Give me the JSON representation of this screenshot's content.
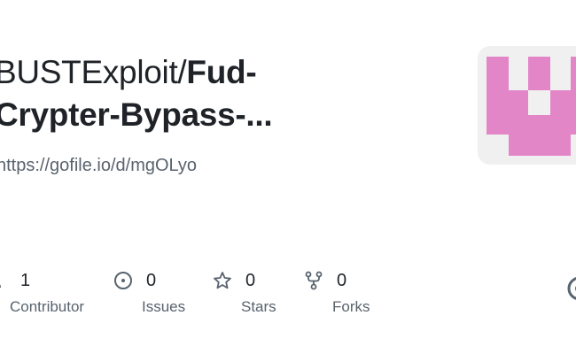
{
  "repo": {
    "owner_prefix": "BUSTExploit/",
    "name_line1": "Fud-",
    "name_line2": "Crypter-Bypass-...",
    "url": "https://gofile.io/d/mgOLyo"
  },
  "colors": {
    "avatar_bg": "#f0f0f0",
    "identicon": "#e386c8",
    "muted_text": "#59636e",
    "icon": "#59636e"
  },
  "stats": [
    {
      "icon": "people-icon",
      "value": "1",
      "label": "Contributor"
    },
    {
      "icon": "issue-opened-icon",
      "value": "0",
      "label": "Issues"
    },
    {
      "icon": "star-icon",
      "value": "0",
      "label": "Stars"
    },
    {
      "icon": "repo-forked-icon",
      "value": "0",
      "label": "Forks"
    }
  ]
}
